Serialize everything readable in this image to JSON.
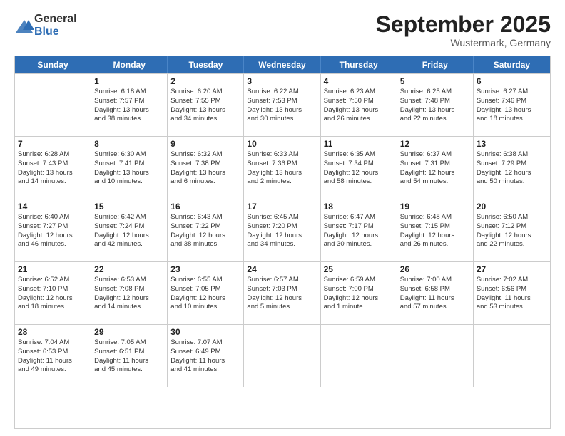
{
  "header": {
    "logo": {
      "general": "General",
      "blue": "Blue"
    },
    "title": "September 2025",
    "location": "Wustermark, Germany"
  },
  "calendar": {
    "days_of_week": [
      "Sunday",
      "Monday",
      "Tuesday",
      "Wednesday",
      "Thursday",
      "Friday",
      "Saturday"
    ],
    "weeks": [
      [
        {
          "day": "",
          "info": ""
        },
        {
          "day": "1",
          "info": "Sunrise: 6:18 AM\nSunset: 7:57 PM\nDaylight: 13 hours\nand 38 minutes."
        },
        {
          "day": "2",
          "info": "Sunrise: 6:20 AM\nSunset: 7:55 PM\nDaylight: 13 hours\nand 34 minutes."
        },
        {
          "day": "3",
          "info": "Sunrise: 6:22 AM\nSunset: 7:53 PM\nDaylight: 13 hours\nand 30 minutes."
        },
        {
          "day": "4",
          "info": "Sunrise: 6:23 AM\nSunset: 7:50 PM\nDaylight: 13 hours\nand 26 minutes."
        },
        {
          "day": "5",
          "info": "Sunrise: 6:25 AM\nSunset: 7:48 PM\nDaylight: 13 hours\nand 22 minutes."
        },
        {
          "day": "6",
          "info": "Sunrise: 6:27 AM\nSunset: 7:46 PM\nDaylight: 13 hours\nand 18 minutes."
        }
      ],
      [
        {
          "day": "7",
          "info": "Sunrise: 6:28 AM\nSunset: 7:43 PM\nDaylight: 13 hours\nand 14 minutes."
        },
        {
          "day": "8",
          "info": "Sunrise: 6:30 AM\nSunset: 7:41 PM\nDaylight: 13 hours\nand 10 minutes."
        },
        {
          "day": "9",
          "info": "Sunrise: 6:32 AM\nSunset: 7:38 PM\nDaylight: 13 hours\nand 6 minutes."
        },
        {
          "day": "10",
          "info": "Sunrise: 6:33 AM\nSunset: 7:36 PM\nDaylight: 13 hours\nand 2 minutes."
        },
        {
          "day": "11",
          "info": "Sunrise: 6:35 AM\nSunset: 7:34 PM\nDaylight: 12 hours\nand 58 minutes."
        },
        {
          "day": "12",
          "info": "Sunrise: 6:37 AM\nSunset: 7:31 PM\nDaylight: 12 hours\nand 54 minutes."
        },
        {
          "day": "13",
          "info": "Sunrise: 6:38 AM\nSunset: 7:29 PM\nDaylight: 12 hours\nand 50 minutes."
        }
      ],
      [
        {
          "day": "14",
          "info": "Sunrise: 6:40 AM\nSunset: 7:27 PM\nDaylight: 12 hours\nand 46 minutes."
        },
        {
          "day": "15",
          "info": "Sunrise: 6:42 AM\nSunset: 7:24 PM\nDaylight: 12 hours\nand 42 minutes."
        },
        {
          "day": "16",
          "info": "Sunrise: 6:43 AM\nSunset: 7:22 PM\nDaylight: 12 hours\nand 38 minutes."
        },
        {
          "day": "17",
          "info": "Sunrise: 6:45 AM\nSunset: 7:20 PM\nDaylight: 12 hours\nand 34 minutes."
        },
        {
          "day": "18",
          "info": "Sunrise: 6:47 AM\nSunset: 7:17 PM\nDaylight: 12 hours\nand 30 minutes."
        },
        {
          "day": "19",
          "info": "Sunrise: 6:48 AM\nSunset: 7:15 PM\nDaylight: 12 hours\nand 26 minutes."
        },
        {
          "day": "20",
          "info": "Sunrise: 6:50 AM\nSunset: 7:12 PM\nDaylight: 12 hours\nand 22 minutes."
        }
      ],
      [
        {
          "day": "21",
          "info": "Sunrise: 6:52 AM\nSunset: 7:10 PM\nDaylight: 12 hours\nand 18 minutes."
        },
        {
          "day": "22",
          "info": "Sunrise: 6:53 AM\nSunset: 7:08 PM\nDaylight: 12 hours\nand 14 minutes."
        },
        {
          "day": "23",
          "info": "Sunrise: 6:55 AM\nSunset: 7:05 PM\nDaylight: 12 hours\nand 10 minutes."
        },
        {
          "day": "24",
          "info": "Sunrise: 6:57 AM\nSunset: 7:03 PM\nDaylight: 12 hours\nand 5 minutes."
        },
        {
          "day": "25",
          "info": "Sunrise: 6:59 AM\nSunset: 7:00 PM\nDaylight: 12 hours\nand 1 minute."
        },
        {
          "day": "26",
          "info": "Sunrise: 7:00 AM\nSunset: 6:58 PM\nDaylight: 11 hours\nand 57 minutes."
        },
        {
          "day": "27",
          "info": "Sunrise: 7:02 AM\nSunset: 6:56 PM\nDaylight: 11 hours\nand 53 minutes."
        }
      ],
      [
        {
          "day": "28",
          "info": "Sunrise: 7:04 AM\nSunset: 6:53 PM\nDaylight: 11 hours\nand 49 minutes."
        },
        {
          "day": "29",
          "info": "Sunrise: 7:05 AM\nSunset: 6:51 PM\nDaylight: 11 hours\nand 45 minutes."
        },
        {
          "day": "30",
          "info": "Sunrise: 7:07 AM\nSunset: 6:49 PM\nDaylight: 11 hours\nand 41 minutes."
        },
        {
          "day": "",
          "info": ""
        },
        {
          "day": "",
          "info": ""
        },
        {
          "day": "",
          "info": ""
        },
        {
          "day": "",
          "info": ""
        }
      ]
    ]
  }
}
